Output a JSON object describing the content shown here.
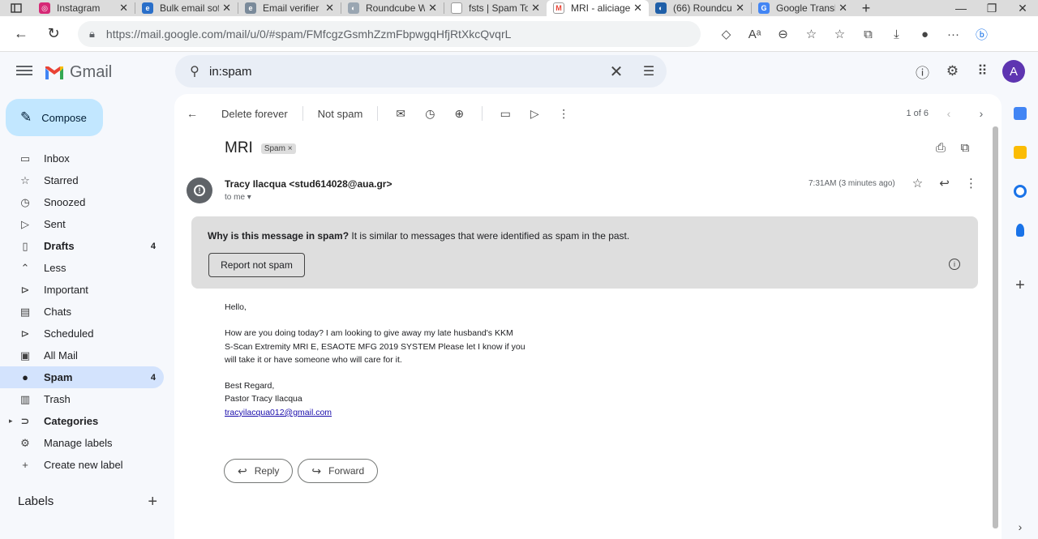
{
  "browser": {
    "tabs": [
      {
        "label": "Instagram",
        "color": "#d62976",
        "glyph": "◎"
      },
      {
        "label": "Bulk email sof",
        "color": "#2a6fc9",
        "glyph": "e"
      },
      {
        "label": "Email verifier",
        "color": "#7a8a9a",
        "glyph": "e"
      },
      {
        "label": "Roundcube W",
        "color": "#9aa6b2",
        "glyph": "◐"
      },
      {
        "label": "fsts | Spam To",
        "color": "#ffffff",
        "glyph": ""
      },
      {
        "label": "MRI - aliciage",
        "color": "#ffffff",
        "glyph": "M"
      },
      {
        "label": "(66) Roundcu",
        "color": "#1f5fa8",
        "glyph": "◐"
      },
      {
        "label": "Google Transl",
        "color": "#4285f4",
        "glyph": "G"
      }
    ],
    "url": "https://mail.google.com/mail/u/0/#spam/FMfcgzGsmhZzmFbpwgqHfjRtXkcQvqrL"
  },
  "gmail": {
    "logo_text": "Gmail",
    "search_value": "in:spam",
    "avatar_letter": "A",
    "compose_label": "Compose",
    "nav": [
      {
        "label": "Inbox",
        "icon": "inbox-icon",
        "glyph": "▭",
        "count": "",
        "bold": false
      },
      {
        "label": "Starred",
        "icon": "star-icon",
        "glyph": "☆",
        "count": "",
        "bold": false
      },
      {
        "label": "Snoozed",
        "icon": "clock-icon",
        "glyph": "◷",
        "count": "",
        "bold": false
      },
      {
        "label": "Sent",
        "icon": "send-icon",
        "glyph": "▷",
        "count": "",
        "bold": false
      },
      {
        "label": "Drafts",
        "icon": "draft-icon",
        "glyph": "▯",
        "count": "4",
        "bold": true
      },
      {
        "label": "Less",
        "icon": "chevron-up-icon",
        "glyph": "⌃",
        "count": "",
        "bold": false
      },
      {
        "label": "Important",
        "icon": "important-icon",
        "glyph": "⊳",
        "count": "",
        "bold": false
      },
      {
        "label": "Chats",
        "icon": "chat-icon",
        "glyph": "▤",
        "count": "",
        "bold": false
      },
      {
        "label": "Scheduled",
        "icon": "scheduled-icon",
        "glyph": "⊳",
        "count": "",
        "bold": false
      },
      {
        "label": "All Mail",
        "icon": "all-mail-icon",
        "glyph": "▣",
        "count": "",
        "bold": false
      },
      {
        "label": "Spam",
        "icon": "spam-icon",
        "glyph": "●",
        "count": "4",
        "bold": true
      },
      {
        "label": "Trash",
        "icon": "trash-icon",
        "glyph": "▥",
        "count": "",
        "bold": false
      },
      {
        "label": "Categories",
        "icon": "label-icon",
        "glyph": "⊃",
        "count": "",
        "bold": true
      },
      {
        "label": "Manage labels",
        "icon": "gear-icon",
        "glyph": "⚙",
        "count": "",
        "bold": false
      },
      {
        "label": "Create new label",
        "icon": "plus-icon",
        "glyph": "+",
        "count": "",
        "bold": false
      }
    ],
    "labels_heading": "Labels",
    "toolbar": {
      "delete_forever": "Delete forever",
      "not_spam": "Not spam",
      "pager": "1 of 6"
    },
    "message": {
      "subject": "MRI",
      "chip": "Spam",
      "sender": "Tracy Ilacqua <stud614028@aua.gr>",
      "to": "to me",
      "time": "7:31AM (3 minutes ago)",
      "banner_bold": "Why is this message in spam?",
      "banner_text": "It is similar to messages that were identified as spam in the past.",
      "report_button": "Report not spam",
      "body_greeting": "Hello,",
      "body_line1": "How are you doing today? I am looking to give away my late husband's KKM",
      "body_line2": "S-Scan Extremity MRI E, ESAOTE MFG 2019 SYSTEM Please let I know if you",
      "body_line3": "will take it or have someone who will care for it.",
      "sign1": "Best Regard,",
      "sign2": "Pastor Tracy Ilacqua",
      "sign_email": "tracyilacqua012@gmail.com",
      "reply_label": "Reply",
      "forward_label": "Forward"
    }
  },
  "colors": {
    "compose_bg": "#c2e7ff",
    "selected_nav": "#d3e3fd",
    "banner_bg": "#dedede",
    "avatar_bg": "#5e35b1"
  }
}
